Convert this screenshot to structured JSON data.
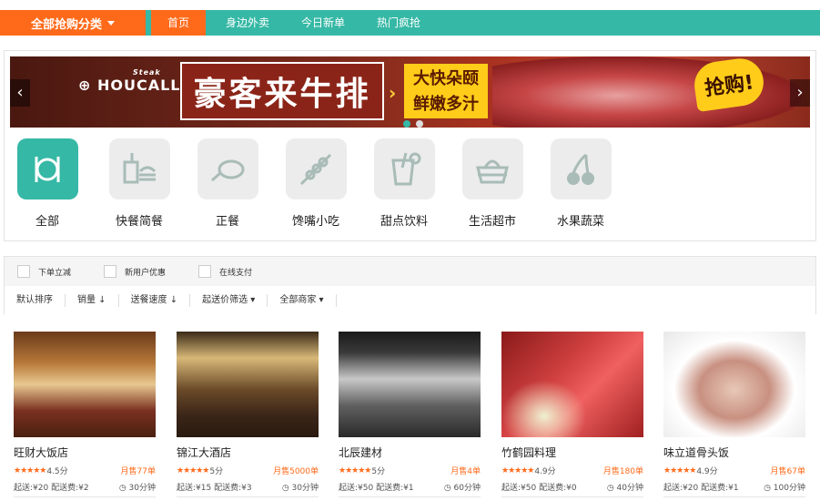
{
  "nav": {
    "category_label": "全部抢购分类",
    "items": [
      "首页",
      "身边外卖",
      "今日新单",
      "热门疯抢"
    ]
  },
  "banner": {
    "logo": "HOUCALLER",
    "logo_small": "Steak",
    "title": "豪客来牛排",
    "sub1": "大快朵颐",
    "sub2": "鲜嫩多汁",
    "badge": "抢购!",
    "prev": "‹",
    "next": "›"
  },
  "categories": [
    {
      "label": "全部",
      "icon": "utensils-icon"
    },
    {
      "label": "快餐简餐",
      "icon": "fastfood-icon"
    },
    {
      "label": "正餐",
      "icon": "chicken-icon"
    },
    {
      "label": "馋嘴小吃",
      "icon": "skewer-icon"
    },
    {
      "label": "甜点饮料",
      "icon": "drink-icon"
    },
    {
      "label": "生活超市",
      "icon": "basket-icon"
    },
    {
      "label": "水果蔬菜",
      "icon": "cherry-icon"
    }
  ],
  "filters": {
    "checks": [
      "下单立减",
      "新用户优惠",
      "在线支付"
    ],
    "sorts": [
      "默认排序",
      "销量 ↓",
      "送餐速度 ↓",
      "起送价筛选 ▾",
      "全部商家 ▾"
    ]
  },
  "shops": [
    {
      "name": "旺财大饭店",
      "stars": "★★★★★",
      "rating": "4.5分",
      "sold": "月售77单",
      "fee": "起送:¥20  配送费:¥2",
      "time": "◷ 30分钟"
    },
    {
      "name": "锦江大酒店",
      "stars": "★★★★★",
      "rating": "5分",
      "sold": "月售5000单",
      "fee": "起送:¥15  配送费:¥3",
      "time": "◷ 30分钟"
    },
    {
      "name": "北辰建材",
      "stars": "★★★★★",
      "rating": "5分",
      "sold": "月售4单",
      "fee": "起送:¥50  配送费:¥1",
      "time": "◷ 60分钟"
    },
    {
      "name": "竹鹤园料理",
      "stars": "★★★★★",
      "rating": "4.9分",
      "sold": "月售180单",
      "fee": "起送:¥50  配送费:¥0",
      "time": "◷ 40分钟"
    },
    {
      "name": "味立道骨头饭",
      "stars": "★★★★★",
      "rating": "4.9分",
      "sold": "月售67单",
      "fee": "起送:¥20  配送费:¥1",
      "time": "◷ 100分钟"
    }
  ]
}
